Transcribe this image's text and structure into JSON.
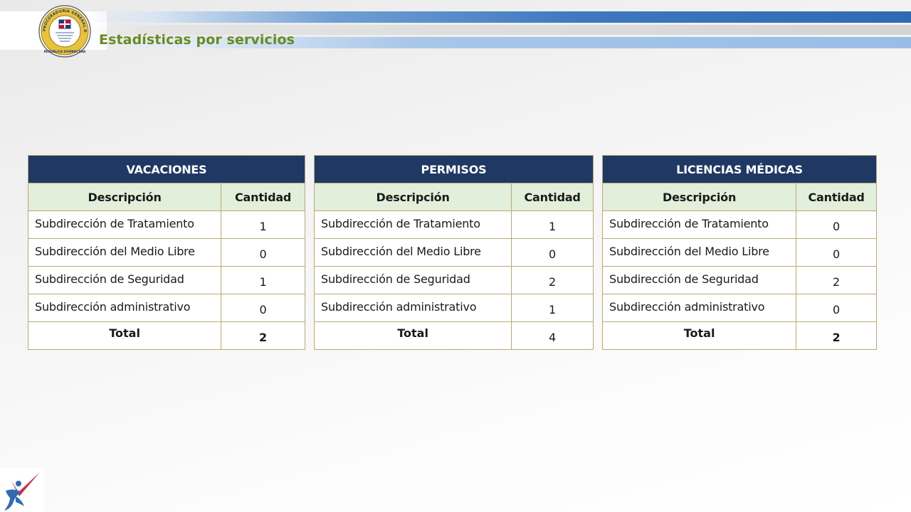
{
  "page": {
    "title": "Estadísticas por servicios"
  },
  "colors": {
    "title_green": "#6b8a1f",
    "table_title_bg": "#203864",
    "table_header_bg": "#e2efda",
    "table_border": "#b8a975"
  },
  "tables": [
    {
      "title": "VACACIONES",
      "col_desc": "Descripción",
      "col_qty": "Cantidad",
      "rows": [
        {
          "desc": "Subdirección de Tratamiento",
          "qty": "1"
        },
        {
          "desc": "Subdirección del Medio Libre",
          "qty": "0"
        },
        {
          "desc": "Subdirección de Seguridad",
          "qty": "1"
        },
        {
          "desc": "Subdirección administrativo",
          "qty": "0"
        }
      ],
      "total_label": "Total",
      "total_value": "2"
    },
    {
      "title": "PERMISOS",
      "col_desc": "Descripción",
      "col_qty": "Cantidad",
      "rows": [
        {
          "desc": "Subdirección de Tratamiento",
          "qty": "1"
        },
        {
          "desc": "Subdirección del Medio Libre",
          "qty": "0"
        },
        {
          "desc": "Subdirección de Seguridad",
          "qty": "2"
        },
        {
          "desc": "Subdirección administrativo",
          "qty": "1"
        }
      ],
      "total_label": "Total",
      "total_value": "4"
    },
    {
      "title": "LICENCIAS MÉDICAS",
      "col_desc": "Descripción",
      "col_qty": "Cantidad",
      "rows": [
        {
          "desc": "Subdirección de Tratamiento",
          "qty": "0"
        },
        {
          "desc": "Subdirección del Medio Libre",
          "qty": "0"
        },
        {
          "desc": "Subdirección de Seguridad",
          "qty": "2"
        },
        {
          "desc": "Subdirección administrativo",
          "qty": "0"
        }
      ],
      "total_label": "Total",
      "total_value": "2"
    }
  ],
  "logos": {
    "seal_icon": "institutional-seal-icon",
    "seal_text": "PROCURADURIA GENERAL DE LA REPUBLICA · REPUBLICA DOMINICANA",
    "corner_icon": "runner-logo-icon"
  }
}
